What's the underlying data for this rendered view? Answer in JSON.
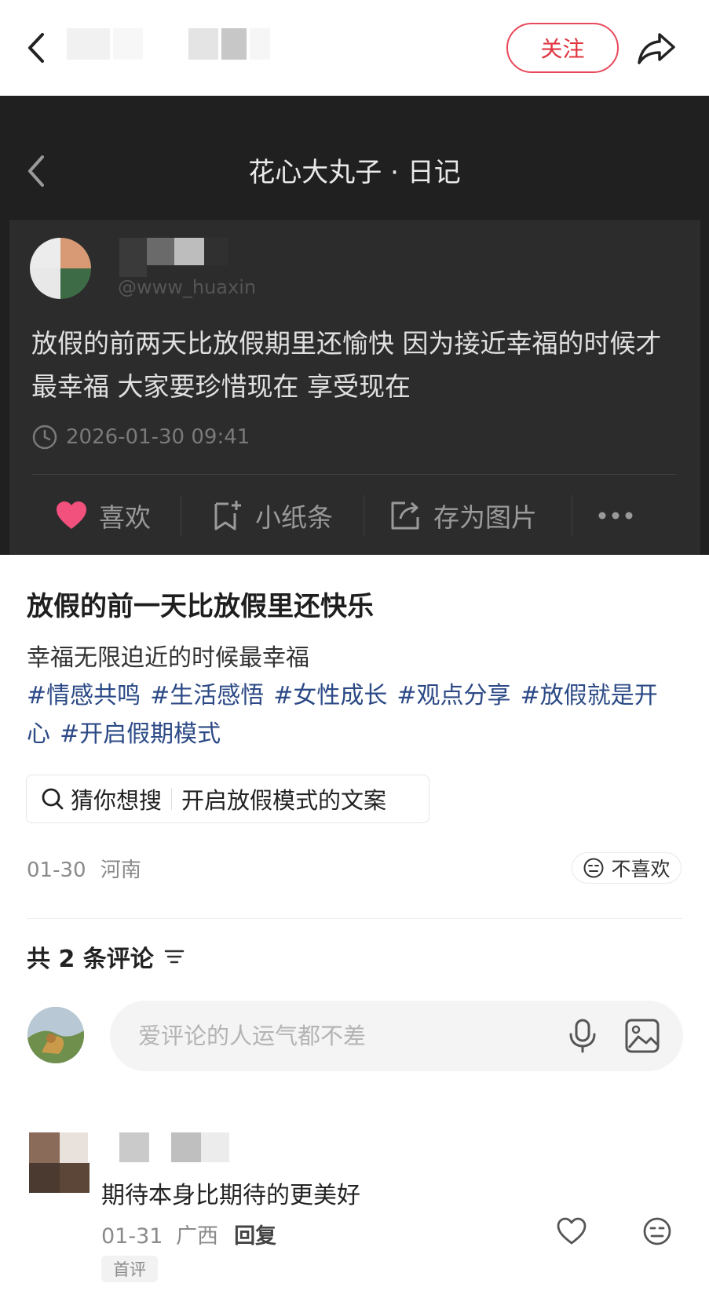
{
  "header": {
    "follow_label": "关注"
  },
  "diary_card": {
    "title": "花心大丸子 · 日记",
    "handle": "@www_huaxin",
    "body": "放假的前两天比放假期里还愉快 因为接近幸福的时候才最幸福 大家要珍惜现在 享受现在",
    "timestamp": "2026-01-30 09:41",
    "actions": {
      "like": "喜欢",
      "note": "小纸条",
      "save_image": "存为图片"
    },
    "colors": {
      "background": "#202020",
      "card": "#2c2c2c",
      "heart": "#f2507d"
    }
  },
  "post": {
    "title": "放假的前一天比放假里还快乐",
    "description": "幸福无限迫近的时候最幸福",
    "tags": [
      "#情感共鸣",
      "#生活感悟",
      "#女性成长",
      "#观点分享",
      "#放假就是开心",
      "#开启假期模式"
    ],
    "search_guess": {
      "label": "猜你想搜",
      "query": "开启放假模式的文案"
    },
    "date": "01-30",
    "location": "河南",
    "dislike_label": "不喜欢",
    "tag_color": "#2c4a86",
    "accent": "#e8485b"
  },
  "comments": {
    "count_label": "共 2 条评论",
    "input_placeholder": "爱评论的人运气都不差",
    "items": [
      {
        "text": "期待本身比期待的更美好",
        "date": "01-31",
        "location": "广西",
        "reply_label": "回复",
        "badge": "首评"
      }
    ]
  }
}
